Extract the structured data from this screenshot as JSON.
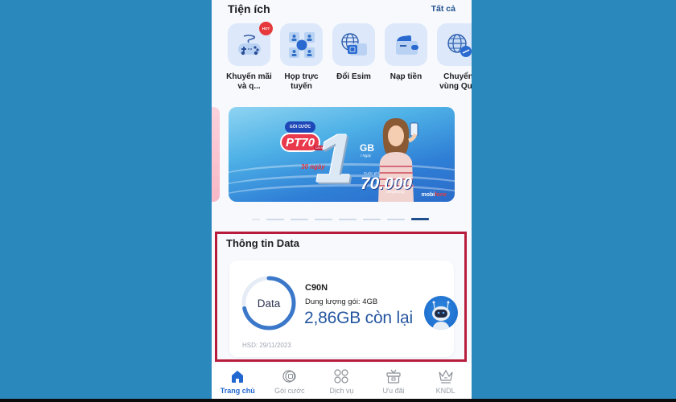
{
  "utilities": {
    "title": "Tiện ích",
    "see_all": "Tất cả",
    "items": [
      {
        "label": "Khuyến mãi và q...",
        "icon": "gamepad-icon",
        "badge": "HOT"
      },
      {
        "label": "Họp trực tuyến",
        "icon": "video-meeting-icon"
      },
      {
        "label": "Đổi Esim",
        "icon": "esim-icon"
      },
      {
        "label": "Nạp tiền",
        "icon": "wallet-icon"
      },
      {
        "label": "Chuyển vùng Quố",
        "icon": "roaming-globe-icon"
      }
    ]
  },
  "banner": {
    "tag": "GÓI CƯỚC",
    "package": "PT70",
    "package_sub": "DATA",
    "days": "30 ngày",
    "amount": "1",
    "unit": "GB",
    "per": "/ Ngày",
    "price_label": "Cước phí",
    "price": "70.000",
    "price_unit": "đồng/tháng",
    "brand_a": "mobi",
    "brand_b": "fone",
    "slide_count": 8,
    "active_slide": 8
  },
  "data_info": {
    "title": "Thông tin Data",
    "ring_label": "Data",
    "package_name": "C90N",
    "capacity": "Dung lượng gói:  4GB",
    "remaining": "2,86GB còn lại",
    "remaining_fraction": 0.715,
    "expiry": "HSD: 29/11/2023",
    "colors": {
      "ring": "#3b78c9",
      "ring_track": "#e6ecf6",
      "highlight_border": "#b81c3c"
    }
  },
  "nav": {
    "items": [
      {
        "label": "Trang chủ",
        "icon": "home-icon",
        "active": true
      },
      {
        "label": "Gói cước",
        "icon": "package-icon",
        "active": false
      },
      {
        "label": "Dịch vụ",
        "icon": "services-grid-icon",
        "active": false
      },
      {
        "label": "Ưu đãi",
        "icon": "gift-icon",
        "active": false
      },
      {
        "label": "KNDL",
        "icon": "crown-icon",
        "active": false
      }
    ],
    "active_color": "#2167d0"
  }
}
